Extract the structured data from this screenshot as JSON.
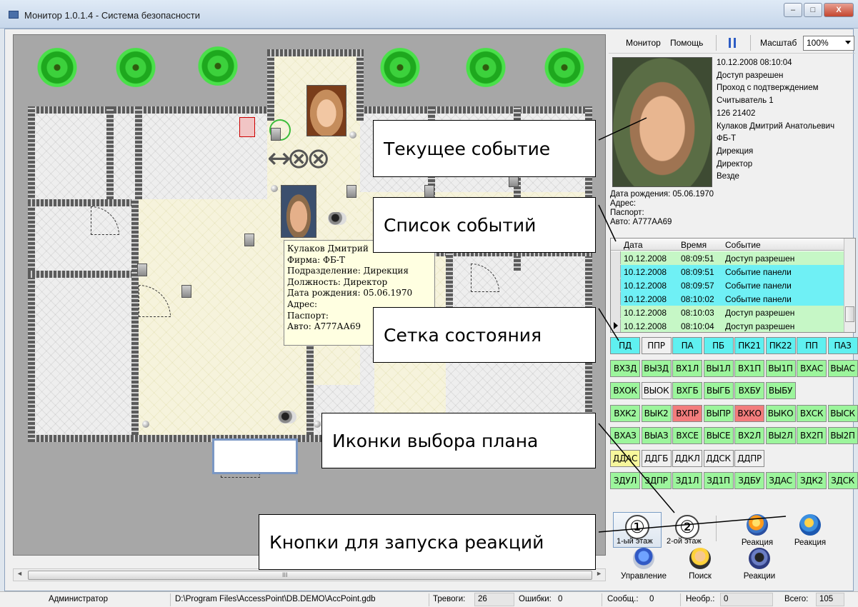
{
  "window": {
    "title": "Монитор 1.0.1.4 - Система безопасности",
    "min_symbol": "–",
    "max_symbol": "□",
    "close_symbol": "X"
  },
  "toolbar": {
    "menu_monitor": "Монитор",
    "menu_help": "Помощь",
    "pause_icon": "pause-icon",
    "scale_label": "Масштаб",
    "scale_value": "100%"
  },
  "current_event": {
    "lines": [
      "10.12.2008 08:10:04",
      "Доступ разрешен",
      "Проход с подтверждением",
      "Считыватель 1",
      "126 21402",
      "Кулаков Дмитрий Анатольевич",
      "ФБ-Т",
      "Дирекция",
      "Директор",
      "Везде"
    ],
    "birth": "Дата рождения: 05.06.1970",
    "address": "Адрес:",
    "passport": "Паспорт:",
    "auto": "Авто: А777АА69"
  },
  "events": {
    "headers": [
      "Дата",
      "Время",
      "Событие"
    ],
    "rows": [
      {
        "date": "10.12.2008",
        "time": "08:09:51",
        "event": "Доступ разрешен",
        "color": "#c6f7c6"
      },
      {
        "date": "10.12.2008",
        "time": "08:09:51",
        "event": "Событие панели",
        "color": "#6ff0f5"
      },
      {
        "date": "10.12.2008",
        "time": "08:09:57",
        "event": "Событие панели",
        "color": "#6ff0f5"
      },
      {
        "date": "10.12.2008",
        "time": "08:10:02",
        "event": "Событие панели",
        "color": "#6ff0f5"
      },
      {
        "date": "10.12.2008",
        "time": "08:10:03",
        "event": "Доступ разрешен",
        "color": "#c6f7c6"
      },
      {
        "date": "10.12.2008",
        "time": "08:10:04",
        "event": "Доступ разрешен",
        "color": "#c6f7c6"
      }
    ]
  },
  "status_grid": [
    [
      {
        "t": "ПД",
        "c": "#5ff0f0"
      },
      {
        "t": "ППР",
        "c": "#f0f0f0"
      },
      {
        "t": "ПА",
        "c": "#5ff0f0"
      },
      {
        "t": "ПБ",
        "c": "#5ff0f0"
      },
      {
        "t": "ПК21",
        "c": "#5ff0f0"
      },
      {
        "t": "ПК22",
        "c": "#5ff0f0"
      },
      {
        "t": "ПП",
        "c": "#5ff0f0"
      },
      {
        "t": "ПАЗ",
        "c": "#5ff0f0"
      }
    ],
    [
      {
        "t": "ВХЗД",
        "c": "#9cf59c"
      },
      {
        "t": "ВЫЗД",
        "c": "#9cf59c"
      },
      {
        "t": "ВХ1Л",
        "c": "#9cf59c"
      },
      {
        "t": "ВЫ1Л",
        "c": "#9cf59c"
      },
      {
        "t": "ВХ1П",
        "c": "#9cf59c"
      },
      {
        "t": "ВЫ1П",
        "c": "#9cf59c"
      },
      {
        "t": "ВХАС",
        "c": "#9cf59c"
      },
      {
        "t": "ВЫАС",
        "c": "#9cf59c"
      }
    ],
    [
      {
        "t": "ВХОК",
        "c": "#9cf59c"
      },
      {
        "t": "ВЫОК",
        "c": "#f0f0f0"
      },
      {
        "t": "ВХГБ",
        "c": "#9cf59c"
      },
      {
        "t": "ВЫГБ",
        "c": "#9cf59c"
      },
      {
        "t": "ВХБУ",
        "c": "#9cf59c"
      },
      {
        "t": "ВЫБУ",
        "c": "#9cf59c"
      }
    ],
    [
      {
        "t": "ВХК2",
        "c": "#9cf59c"
      },
      {
        "t": "ВЫК2",
        "c": "#9cf59c"
      },
      {
        "t": "ВХПР",
        "c": "#f27c7c"
      },
      {
        "t": "ВЫПР",
        "c": "#9cf59c"
      },
      {
        "t": "ВХКО",
        "c": "#f27c7c"
      },
      {
        "t": "ВЫКО",
        "c": "#9cf59c"
      },
      {
        "t": "ВХСК",
        "c": "#9cf59c"
      },
      {
        "t": "ВЫСК",
        "c": "#9cf59c"
      }
    ],
    [
      {
        "t": "ВХАЗ",
        "c": "#9cf59c"
      },
      {
        "t": "ВЫАЗ",
        "c": "#9cf59c"
      },
      {
        "t": "ВХСЕ",
        "c": "#9cf59c"
      },
      {
        "t": "ВЫСЕ",
        "c": "#9cf59c"
      },
      {
        "t": "ВХ2Л",
        "c": "#9cf59c"
      },
      {
        "t": "ВЫ2Л",
        "c": "#9cf59c"
      },
      {
        "t": "ВХ2П",
        "c": "#9cf59c"
      },
      {
        "t": "ВЫ2П",
        "c": "#9cf59c"
      }
    ],
    [
      {
        "t": "ДДАС",
        "c": "#f7f79c"
      },
      {
        "t": "ДДГБ",
        "c": "#f0f0f0"
      },
      {
        "t": "ДДКЛ",
        "c": "#f0f0f0"
      },
      {
        "t": "ДДСК",
        "c": "#f0f0f0"
      },
      {
        "t": "ДДПР",
        "c": "#f0f0f0"
      }
    ],
    [
      {
        "t": "ЗДУЛ",
        "c": "#9cf59c"
      },
      {
        "t": "ЗДПР",
        "c": "#9cf59c"
      },
      {
        "t": "ЗД1Л",
        "c": "#9cf59c"
      },
      {
        "t": "ЗД1П",
        "c": "#9cf59c"
      },
      {
        "t": "ЗДБУ",
        "c": "#9cf59c"
      },
      {
        "t": "ЗДАС",
        "c": "#9cf59c"
      },
      {
        "t": "ЗДК2",
        "c": "#9cf59c"
      },
      {
        "t": "ЗДСК",
        "c": "#9cf59c"
      }
    ]
  ],
  "plans": [
    {
      "num": "①",
      "label": "1-ый этаж",
      "selected": true
    },
    {
      "num": "②",
      "label": "2-ой этаж",
      "selected": false
    }
  ],
  "reactions": {
    "fire_label": "Реакция",
    "alarm_label": "Реакция",
    "control_label": "Управление",
    "search_label": "Поиск",
    "reactions_label": "Реакции"
  },
  "tooltip": {
    "lines": [
      "Кулаков Дмитрий",
      "Фирма: ФБ-Т",
      "Подразделение: Дирекция",
      "Должность: Директор",
      "Дата рождения: 05.06.1970",
      "Адрес:",
      "Паспорт:",
      "Авто: А777АА69"
    ]
  },
  "callouts": {
    "current": "Текущее событие",
    "list": "Список событий",
    "grid": "Сетка состояния",
    "plans": "Иконки выбора плана",
    "buttons": "Кнопки для запуска реакций"
  },
  "scroll": {
    "left": "◄",
    "right": "►",
    "grip": "III"
  },
  "statusbar": {
    "user": "Администратор",
    "db_path": "D:\\Program Files\\AccessPoint\\DB.DEMO\\AccPoint.gdb",
    "alarms_label": "Тревоги:",
    "alarms_value": "26",
    "errors_label": "Ошибки:",
    "errors_value": "0",
    "messages_label": "Сообщ.:",
    "messages_value": "0",
    "unprocessed_label": "Необр.:",
    "unprocessed_value": "0",
    "total_label": "Всего:",
    "total_value": "105"
  },
  "colors": {
    "event_ok": "#c6f7c6",
    "event_panel": "#6ff0f5",
    "alarm": "#f27c7c",
    "warning": "#f7f79c",
    "idle": "#f0f0f0"
  }
}
